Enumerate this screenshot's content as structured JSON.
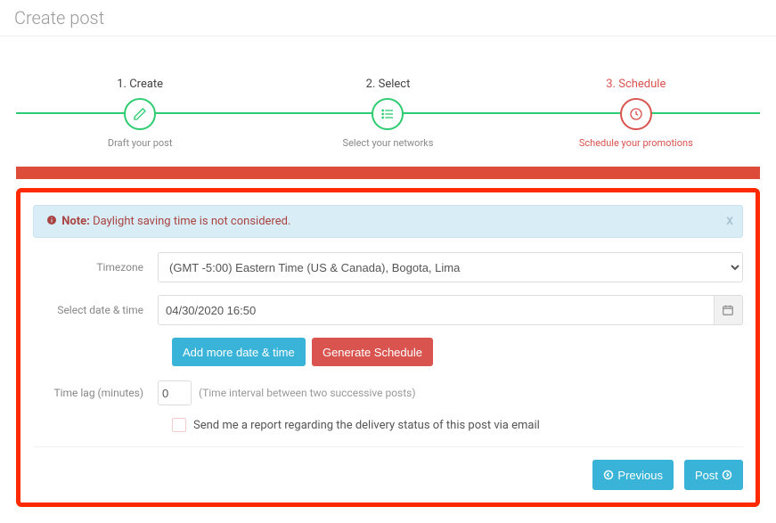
{
  "page_title": "Create post",
  "steps": {
    "s1": {
      "label": "1. Create",
      "caption": "Draft your post"
    },
    "s2": {
      "label": "2. Select",
      "caption": "Select your networks"
    },
    "s3": {
      "label": "3. Schedule",
      "caption": "Schedule your promotions"
    }
  },
  "alert": {
    "note_prefix": "Note:",
    "text": "Daylight saving time is not considered.",
    "close": "x"
  },
  "form": {
    "timezone": {
      "label": "Timezone",
      "value": "(GMT -5:00) Eastern Time (US & Canada), Bogota, Lima"
    },
    "datetime": {
      "label": "Select date & time",
      "value": "04/30/2020 16:50"
    },
    "buttons": {
      "add_more": "Add more date & time",
      "generate": "Generate Schedule"
    },
    "timelag": {
      "label": "Time lag (minutes)",
      "value": "0",
      "hint": "(Time interval between two successive posts)"
    },
    "email_report": {
      "label": "Send me a report regarding the delivery status of this post via email"
    }
  },
  "nav": {
    "previous": "Previous",
    "post": "Post"
  },
  "icons": {
    "step1": "pencil-icon",
    "step2": "list-icon",
    "step3": "clock-icon",
    "calendar": "calendar-icon",
    "prev": "arrow-left-icon",
    "next": "arrow-right-icon",
    "info": "info-icon"
  }
}
